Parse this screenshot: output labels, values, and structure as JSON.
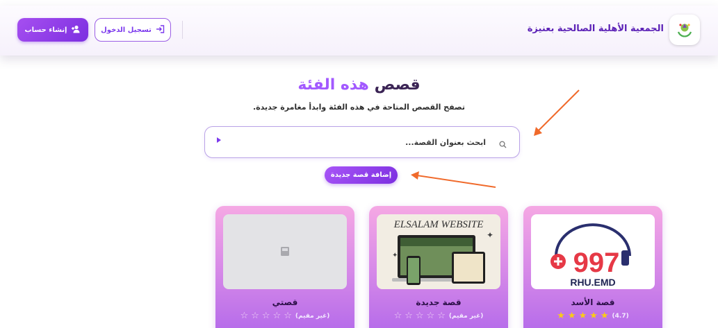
{
  "header": {
    "brand_name": "الجمعية الأهلية الصالحية بعنيزة",
    "logo_icon": "association-logo-icon",
    "signup_label": "إنشاء حساب",
    "signup_icon": "user-plus-icon",
    "login_label": "تسجيل الدخول",
    "login_icon": "login-icon"
  },
  "main": {
    "title_plain": "قصص",
    "title_accent": "هذه الفئة",
    "subtitle": "تصفح القصص المتاحة في هذه الفئة وابدأ مغامرة جديدة.",
    "search": {
      "placeholder": "ابحث بعنوان القصة...",
      "value": ""
    },
    "add_story_label": "إضافة قصة جديدة"
  },
  "stories": [
    {
      "title": "قصة الأسد",
      "rating": 4.7,
      "stars_filled": 5,
      "rating_text": "(4.7)",
      "image": "logo-997-rhu-emd",
      "image_text_main": "997",
      "image_text_sub": "RHU.EMD"
    },
    {
      "title": "قصة جديدة",
      "rating": 0,
      "stars_filled": 0,
      "rating_text": "(غير مقيم)",
      "image": "elsalam-website-devices",
      "image_text_main": "ELSALAM WEBSITE"
    },
    {
      "title": "قصتي",
      "rating": 0,
      "stars_filled": 0,
      "rating_text": "(غير مقيم)",
      "image": "placeholder-image-icon"
    }
  ],
  "colors": {
    "accent": "#a259ff",
    "button_purple": "#7c2fe0",
    "star_on": "#facc15",
    "annotation_arrow": "#f06a2b",
    "card_gradient_top": "#f5a8e4",
    "card_gradient_bottom": "#b268ea"
  }
}
